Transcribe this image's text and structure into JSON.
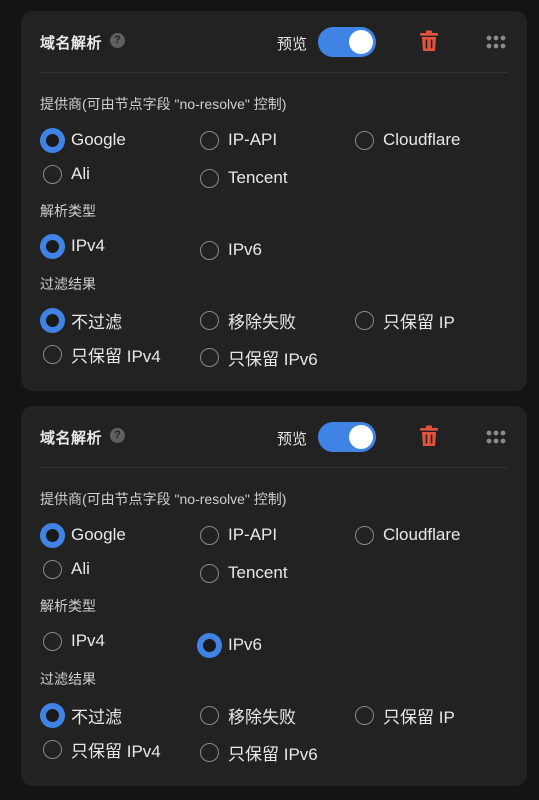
{
  "cards": [
    {
      "title": "域名解析",
      "help_icon": "question-circle-icon",
      "preview_label": "预览",
      "preview_enabled": true,
      "provider": {
        "label": "提供商(可由节点字段 \"no-resolve\" 控制)",
        "options": [
          "Google",
          "IP-API",
          "Cloudflare",
          "Ali",
          "Tencent"
        ],
        "selected": "Google"
      },
      "type": {
        "label": "解析类型",
        "options": [
          "IPv4",
          "IPv6"
        ],
        "selected": "IPv4"
      },
      "filter": {
        "label": "过滤结果",
        "options": [
          "不过滤",
          "移除失败",
          "只保留 IP",
          "只保留 IPv4",
          "只保留 IPv6"
        ],
        "selected": "不过滤"
      }
    },
    {
      "title": "域名解析",
      "help_icon": "question-circle-icon",
      "preview_label": "预览",
      "preview_enabled": true,
      "provider": {
        "label": "提供商(可由节点字段 \"no-resolve\" 控制)",
        "options": [
          "Google",
          "IP-API",
          "Cloudflare",
          "Ali",
          "Tencent"
        ],
        "selected": "Google"
      },
      "type": {
        "label": "解析类型",
        "options": [
          "IPv4",
          "IPv6"
        ],
        "selected": "IPv6"
      },
      "filter": {
        "label": "过滤结果",
        "options": [
          "不过滤",
          "移除失败",
          "只保留 IP",
          "只保留 IPv4",
          "只保留 IPv6"
        ],
        "selected": "不过滤"
      }
    }
  ],
  "colors": {
    "accent": "#3f84e5",
    "delete": "#e5533d",
    "card": "#222222",
    "background": "#141414"
  }
}
